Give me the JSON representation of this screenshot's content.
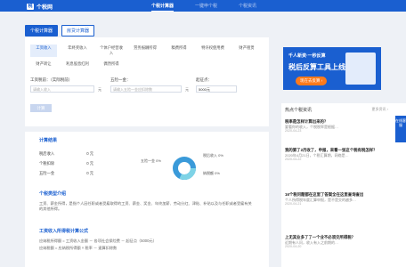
{
  "header": {
    "logo": "个税网",
    "nav": [
      "个税计算器",
      "一键申个税",
      "个税资讯"
    ]
  },
  "tabs": [
    "个税计算器",
    "房贷计算器"
  ],
  "categories": [
    "工资收入",
    "年终奖收入",
    "个体户经营收入",
    "劳务报酬所得",
    "稿费所得",
    "特许权使用费",
    "财产租赁",
    "财产转让",
    "利息股息红利",
    "偶然所得"
  ],
  "form": {
    "salary_label": "工资税前：（实际税前）",
    "salary_placeholder": "请输入收入",
    "insurance_label": "五险一金：",
    "insurance_placeholder": "请输入五险一金应扣除数",
    "threshold_label": "起征点：",
    "threshold_value": "5000元",
    "unit": "元",
    "calc_button": "计算"
  },
  "result": {
    "title": "计算结果",
    "rows": [
      {
        "label": "税后收入",
        "value": "0 元"
      },
      {
        "label": "个税扣除",
        "value": "0 元"
      },
      {
        "label": "五险一金",
        "value": "0 元"
      }
    ],
    "legend": [
      "五险一金 0%",
      "税后收入 0%",
      "纳税额 0%"
    ],
    "intro_title": "个税类型介绍",
    "intro_text": "工资、薪金所得，是指个人因任职或者受雇取得的工资、薪金、奖金、年终加薪、劳动分红、津贴、补贴以及与任职或者受雇有关的其他所得。",
    "formula_title": "工资收入所得税计算公式",
    "formula_text_1": "应纳税所得额 = 工资收入金额 － 各项社会保险费 － 起征点（5000元）",
    "formula_text_2": "应纳税额 = 应纳税所得额 × 税率 － 速算扣除数"
  },
  "ad": {
    "line1": "千人新资·一秒反算",
    "line2": "税后反算工具上线啦！",
    "button": "现在去反算 ›"
  },
  "qa": {
    "title": "热点个税资讯",
    "more": "更多资讯 ›",
    "items": [
      {
        "q": "税率是怎样计算出来的？",
        "a": "要看你的收入，个税税率是根据…",
        "d": "2020-04-23"
      },
      {
        "q": "我的第了2月收了，申报，来看一张这个税有税怎样？",
        "a": "2020年4月21日，个税汇算期，网络是…",
        "d": "2020-04-22"
      },
      {
        "q": "16个税问题都在这里了答案全在这里查询查出",
        "a": "个人所得税年度汇算申报，是不是交的越多…",
        "d": "2020-04-21"
      },
      {
        "q": "上无其业多了了一个业不必须交所得税？",
        "a": "近期有人问，收入有入之前期的…",
        "d": "2020-04-20"
      }
    ]
  },
  "float_label": "在线客服"
}
